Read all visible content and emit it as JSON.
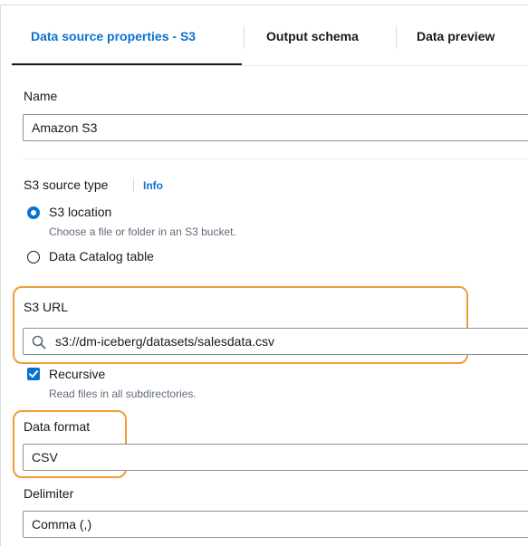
{
  "tabs": [
    {
      "label": "Data source properties - S3",
      "active": true
    },
    {
      "label": "Output schema",
      "active": false
    },
    {
      "label": "Data preview",
      "active": false
    }
  ],
  "name_field": {
    "label": "Name",
    "value": "Amazon S3"
  },
  "source_type": {
    "label": "S3 source type",
    "info_label": "Info",
    "options": [
      {
        "label": "S3 location",
        "description": "Choose a file or folder in an S3 bucket.",
        "selected": true
      },
      {
        "label": "Data Catalog table",
        "selected": false
      }
    ]
  },
  "s3_url": {
    "label": "S3 URL",
    "value": "s3://dm-iceberg/datasets/salesdata.csv",
    "icon": "search-icon"
  },
  "recursive": {
    "label": "Recursive",
    "description": "Read files in all subdirectories.",
    "checked": true
  },
  "data_format": {
    "label": "Data format",
    "value": "CSV"
  },
  "delimiter": {
    "label": "Delimiter",
    "value": "Comma (,)"
  },
  "colors": {
    "accent": "#0972d3",
    "highlight": "#f29b38",
    "text": "#16191f",
    "muted": "#5f6b7a"
  }
}
